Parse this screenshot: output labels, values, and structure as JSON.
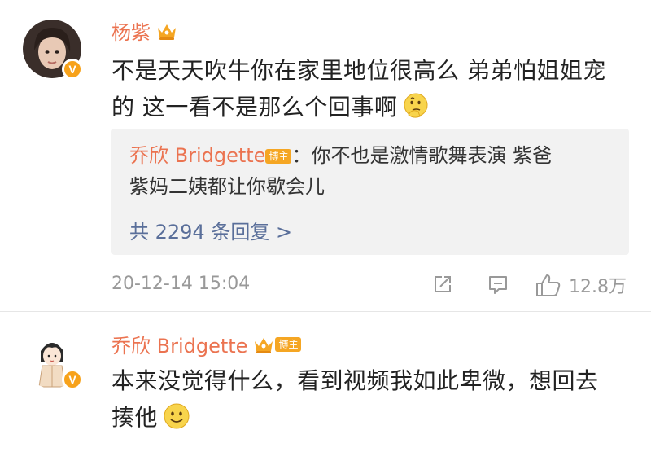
{
  "comments": [
    {
      "username": "杨紫",
      "has_crown": true,
      "text_line1": "不是天天吹牛你在家里地位很高么 弟弟怕姐姐宠",
      "text_line2": "的 这一看不是那么个回事啊",
      "emoji": "thinking-emoji",
      "reply": {
        "author": "乔欣 Bridgette",
        "author_badge": "博主",
        "text_line1": "：你不也是激情歌舞表演 紫爸",
        "text_line2": "紫妈二姨都让你歇会儿",
        "count_label": "共 2294 条回复 >"
      },
      "timestamp": "20-12-14 15:04",
      "likes": "12.8万"
    },
    {
      "username": "乔欣 Bridgette",
      "author_badge": "博主",
      "has_crown": true,
      "text_line1": "本来没觉得什么，看到视频我如此卑微，想回去",
      "text_line2": "揍他",
      "emoji": "smile-emoji"
    }
  ],
  "colors": {
    "username": "#eb7350",
    "reply_count": "#5a6f9a",
    "badge": "#f5a623",
    "meta": "#999999"
  }
}
